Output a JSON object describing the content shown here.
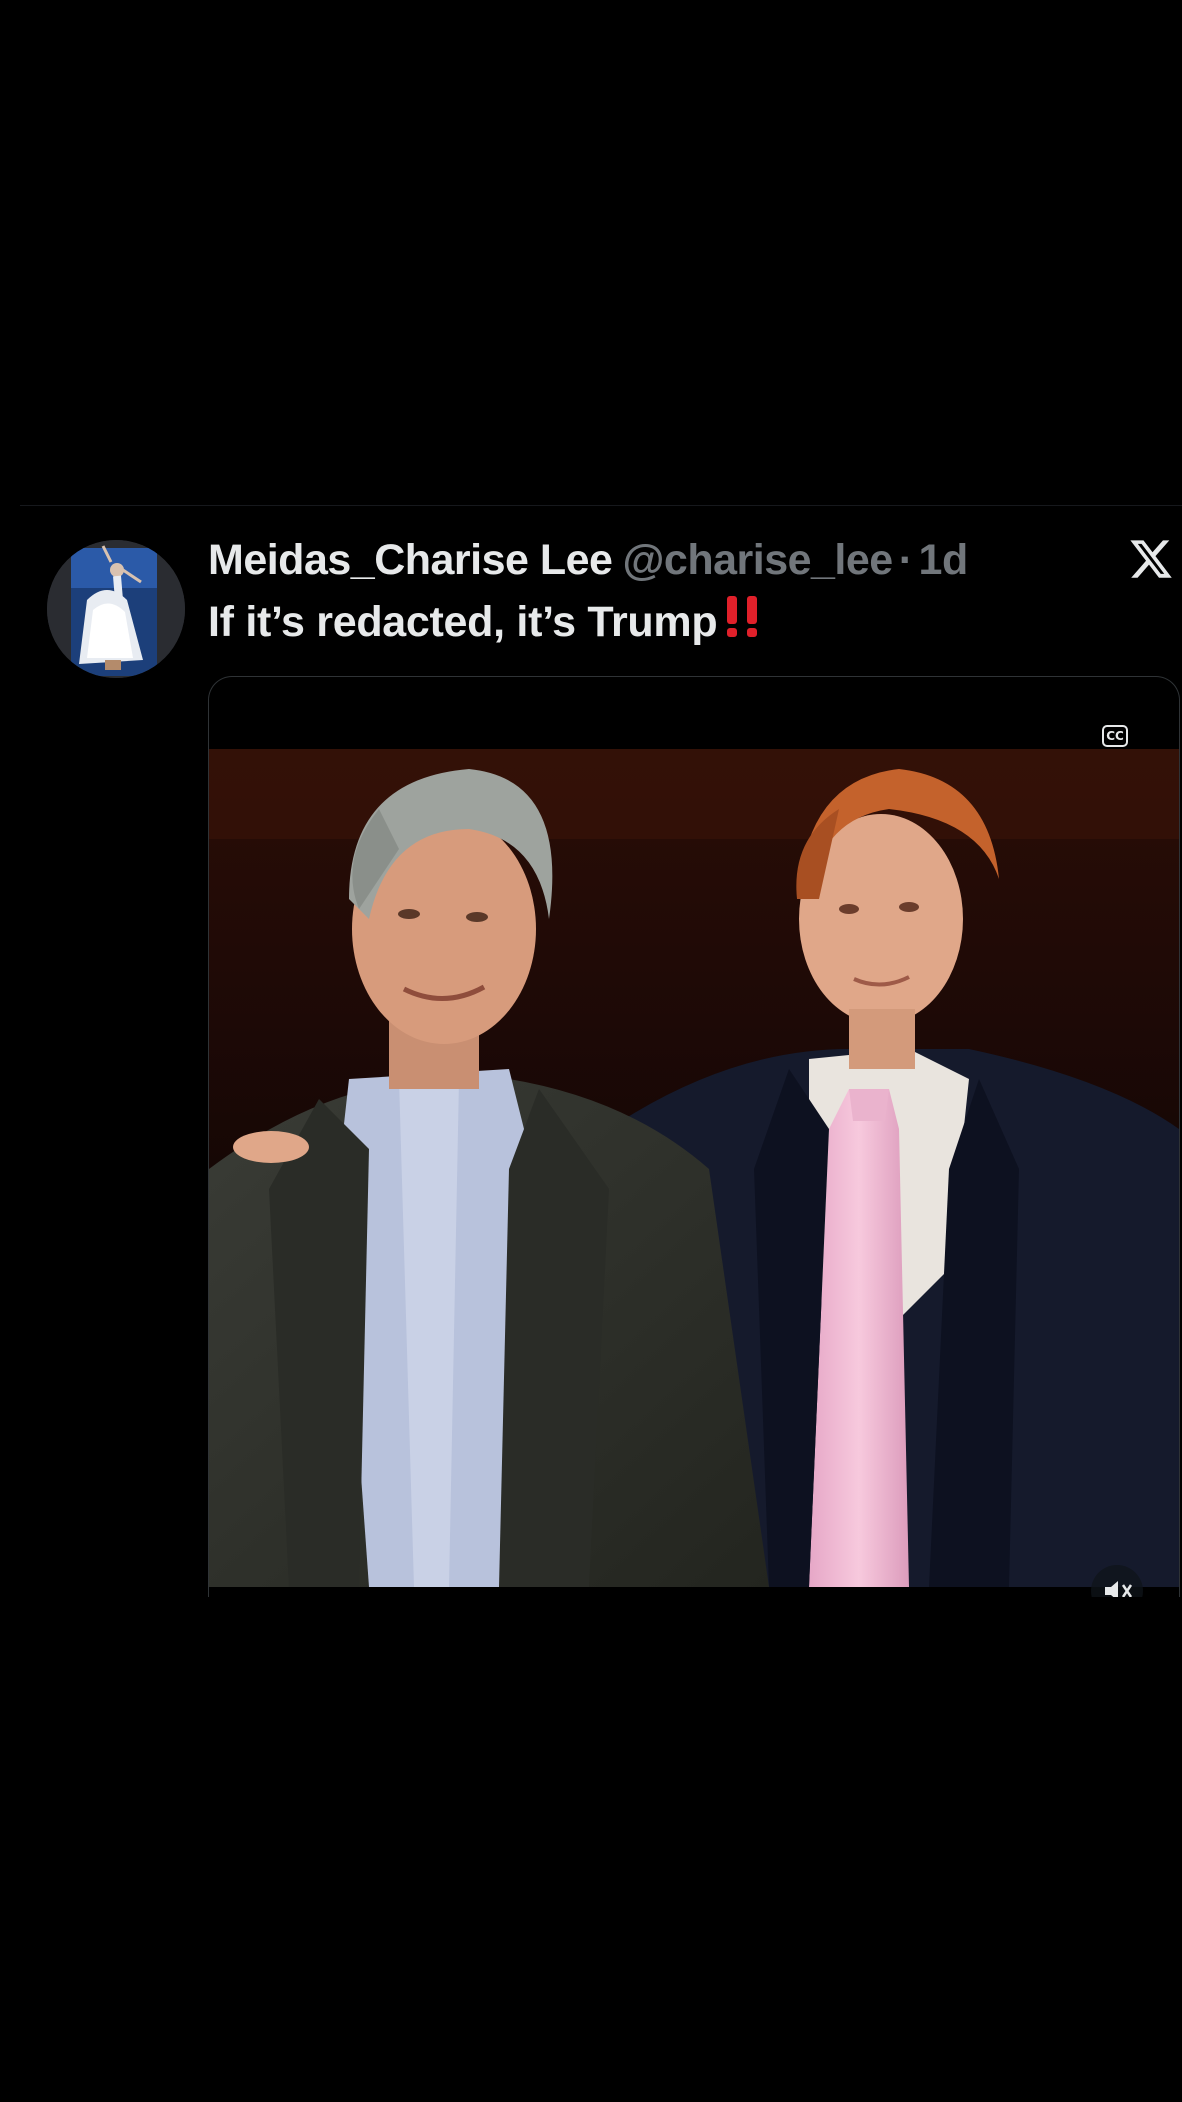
{
  "post": {
    "display_name": "Meidas_Charise Lee",
    "handle": "@charise_lee",
    "separator": "·",
    "time": "1d",
    "text": "If it’s redacted, it’s Trump",
    "emoji": "‼️",
    "media": {
      "cc_label": "CC",
      "photo_description_icon": "photo-of-two-men"
    }
  },
  "icons": {
    "x_logo": "x-logo-icon",
    "captions": "closed-captions-icon",
    "mute": "mute-icon"
  },
  "colors": {
    "background": "#000000",
    "primary_text": "#e7e9ea",
    "secondary_text": "#71767b",
    "emoji_red": "#e0202a"
  }
}
